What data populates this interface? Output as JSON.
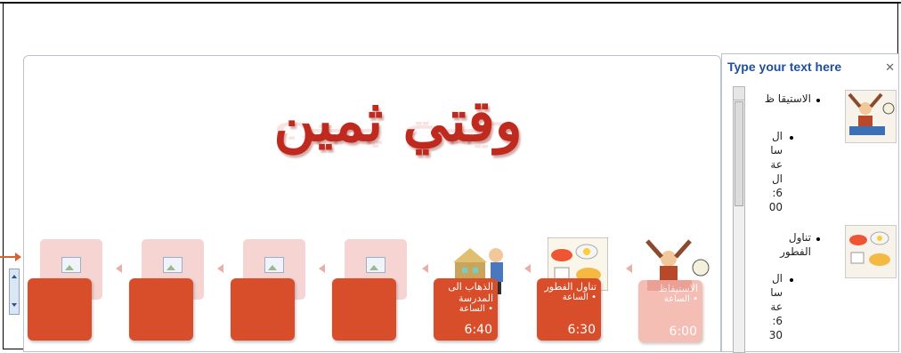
{
  "slide": {
    "title": "وقتي ثمين",
    "boxes": [
      {
        "heading": "الاستيقاظ",
        "bullet": "• الساعة",
        "time": "6:00"
      },
      {
        "heading": "تناول الفطور",
        "bullet": "• الساعة",
        "time": "6:30"
      },
      {
        "heading": "الذهاب الى المدرسة",
        "bullet": "• الساعة",
        "time": "6:40"
      },
      {
        "heading": "",
        "bullet": "",
        "time": ""
      },
      {
        "heading": "",
        "bullet": "",
        "time": ""
      },
      {
        "heading": "",
        "bullet": "",
        "time": ""
      }
    ]
  },
  "text_pane": {
    "header": "Type your text here",
    "close_icon": "close-icon",
    "items": [
      {
        "main": "الاستيقا ظ",
        "sub": [
          "ال",
          "سا",
          "عة",
          "ال",
          "6:",
          "00"
        ]
      },
      {
        "main": "تناول الفطور",
        "sub": [
          "ال",
          "سا",
          "عة",
          "6:",
          "30"
        ]
      }
    ]
  },
  "colors": {
    "accent": "#d94e2a",
    "title": "#c02a1e",
    "pane_header": "#1f4e9c"
  }
}
